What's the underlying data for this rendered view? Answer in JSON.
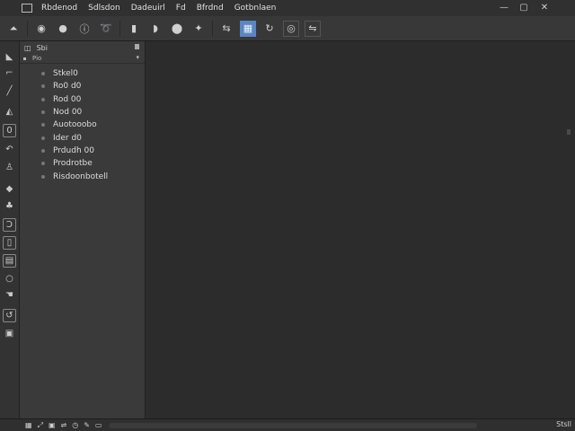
{
  "menubar": {
    "menus": [
      "Rbdenod",
      "Sdlsdon",
      "Dadeuirl",
      "Fd",
      "Bfrdnd",
      "Gotbnlaen"
    ],
    "window_controls": [
      "—",
      "▢",
      "✕"
    ]
  },
  "toolbar": {
    "icons": [
      "triangle-flag-icon",
      "eye-icon",
      "circle-dot-icon",
      "info-icon",
      "lasso-icon",
      "document-icon",
      "bookmark-icon",
      "paint-drop-icon",
      "sparkle-icon",
      "arrow-pair-icon",
      "grid-icon",
      "rotate-icon",
      "target-icon",
      "mirror-icon"
    ]
  },
  "left_tools": {
    "icons": [
      "triangle-icon",
      "eyeglasses-icon",
      "brush-icon",
      "mountain-icon",
      "square-letter-icon",
      "curve-icon",
      "person-icon",
      "bucket-icon",
      "stamp-icon",
      "bracket-icon",
      "frame-icon",
      "layout-icon",
      "circle-outline-icon",
      "hand-icon",
      "swirl-icon",
      "gear-icon"
    ]
  },
  "panel": {
    "title": "Sbi",
    "sub_label": "Pio",
    "items": [
      {
        "label": "Stkel0"
      },
      {
        "label": "Ro0 d0"
      },
      {
        "label": "Rod 00"
      },
      {
        "label": "Nod 00"
      },
      {
        "label": "Auotooobo"
      },
      {
        "label": "Ider d0"
      },
      {
        "label": "Prdudh 00"
      },
      {
        "label": "Prodrotbe"
      },
      {
        "label": "Risdoonbotell"
      }
    ]
  },
  "status": {
    "text": "Stsll",
    "left_icons": [
      "grid-icon",
      "resize-icon",
      "layers-icon",
      "swap-icon",
      "clock-icon",
      "wand-icon",
      "pen-icon"
    ]
  }
}
